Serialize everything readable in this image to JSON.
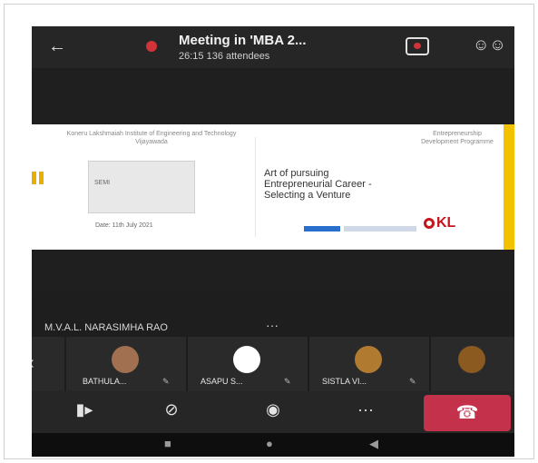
{
  "meeting": {
    "title": "Meeting in 'MBA 2...",
    "subtitle": "26:15   136 attendees"
  },
  "icons": {
    "back": "back-arrow-icon",
    "recording": "recording-dot-icon",
    "share": "share-screen-icon",
    "participants": "participants-icon"
  },
  "slide": {
    "left_header": "Koneru Lakshmaiah Institute of Engineering and Technology Vijayawada",
    "card_text": "SEMI",
    "date": "Date: 11th July 2021",
    "right_header": "Entrepreneurship Development Programme",
    "main_text": [
      "Art of pursuing",
      "Entrepreneurial Career -",
      "Selecting a Venture"
    ],
    "logo_text": "KL",
    "accent_color": "#f2c200"
  },
  "presenter": {
    "name": "M.V.A.L. NARASIMHA RAO",
    "more": "···"
  },
  "participants": [
    {
      "name": "BATHULA...",
      "avatar_color": "#a07050"
    },
    {
      "name": "ASAPU S...",
      "avatar_color": "#ffffff"
    },
    {
      "name": "SISTLA VI...",
      "avatar_color": "#b07a30"
    },
    {
      "name": "",
      "avatar_color": "#8a5a20"
    }
  ],
  "controls": {
    "camera": "camera-icon",
    "mic": "mic-off-icon",
    "speaker": "speaker-icon",
    "more": "···",
    "hangup": "hangup-icon",
    "hangup_color": "#c4314b"
  }
}
